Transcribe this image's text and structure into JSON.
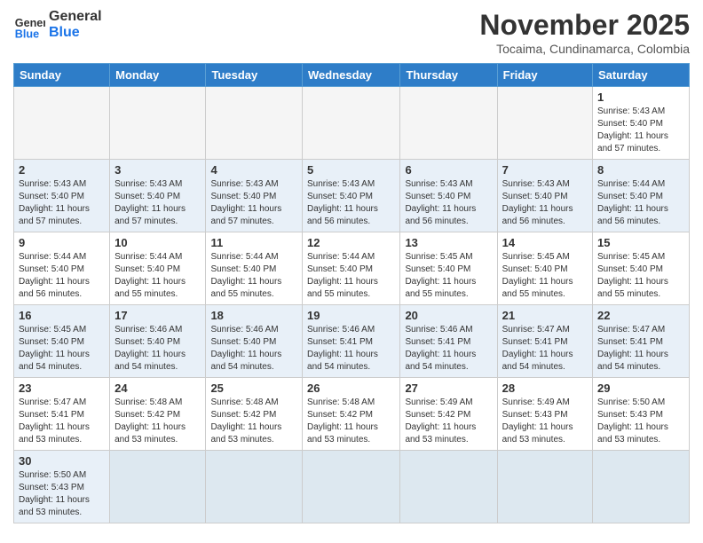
{
  "header": {
    "logo_general": "General",
    "logo_blue": "Blue",
    "month_title": "November 2025",
    "subtitle": "Tocaima, Cundinamarca, Colombia"
  },
  "days_of_week": [
    "Sunday",
    "Monday",
    "Tuesday",
    "Wednesday",
    "Thursday",
    "Friday",
    "Saturday"
  ],
  "weeks": [
    [
      {
        "day": "",
        "info": ""
      },
      {
        "day": "",
        "info": ""
      },
      {
        "day": "",
        "info": ""
      },
      {
        "day": "",
        "info": ""
      },
      {
        "day": "",
        "info": ""
      },
      {
        "day": "",
        "info": ""
      },
      {
        "day": "1",
        "info": "Sunrise: 5:43 AM\nSunset: 5:40 PM\nDaylight: 11 hours\nand 57 minutes."
      }
    ],
    [
      {
        "day": "2",
        "info": "Sunrise: 5:43 AM\nSunset: 5:40 PM\nDaylight: 11 hours\nand 57 minutes."
      },
      {
        "day": "3",
        "info": "Sunrise: 5:43 AM\nSunset: 5:40 PM\nDaylight: 11 hours\nand 57 minutes."
      },
      {
        "day": "4",
        "info": "Sunrise: 5:43 AM\nSunset: 5:40 PM\nDaylight: 11 hours\nand 57 minutes."
      },
      {
        "day": "5",
        "info": "Sunrise: 5:43 AM\nSunset: 5:40 PM\nDaylight: 11 hours\nand 56 minutes."
      },
      {
        "day": "6",
        "info": "Sunrise: 5:43 AM\nSunset: 5:40 PM\nDaylight: 11 hours\nand 56 minutes."
      },
      {
        "day": "7",
        "info": "Sunrise: 5:43 AM\nSunset: 5:40 PM\nDaylight: 11 hours\nand 56 minutes."
      },
      {
        "day": "8",
        "info": "Sunrise: 5:44 AM\nSunset: 5:40 PM\nDaylight: 11 hours\nand 56 minutes."
      }
    ],
    [
      {
        "day": "9",
        "info": "Sunrise: 5:44 AM\nSunset: 5:40 PM\nDaylight: 11 hours\nand 56 minutes."
      },
      {
        "day": "10",
        "info": "Sunrise: 5:44 AM\nSunset: 5:40 PM\nDaylight: 11 hours\nand 55 minutes."
      },
      {
        "day": "11",
        "info": "Sunrise: 5:44 AM\nSunset: 5:40 PM\nDaylight: 11 hours\nand 55 minutes."
      },
      {
        "day": "12",
        "info": "Sunrise: 5:44 AM\nSunset: 5:40 PM\nDaylight: 11 hours\nand 55 minutes."
      },
      {
        "day": "13",
        "info": "Sunrise: 5:45 AM\nSunset: 5:40 PM\nDaylight: 11 hours\nand 55 minutes."
      },
      {
        "day": "14",
        "info": "Sunrise: 5:45 AM\nSunset: 5:40 PM\nDaylight: 11 hours\nand 55 minutes."
      },
      {
        "day": "15",
        "info": "Sunrise: 5:45 AM\nSunset: 5:40 PM\nDaylight: 11 hours\nand 55 minutes."
      }
    ],
    [
      {
        "day": "16",
        "info": "Sunrise: 5:45 AM\nSunset: 5:40 PM\nDaylight: 11 hours\nand 54 minutes."
      },
      {
        "day": "17",
        "info": "Sunrise: 5:46 AM\nSunset: 5:40 PM\nDaylight: 11 hours\nand 54 minutes."
      },
      {
        "day": "18",
        "info": "Sunrise: 5:46 AM\nSunset: 5:40 PM\nDaylight: 11 hours\nand 54 minutes."
      },
      {
        "day": "19",
        "info": "Sunrise: 5:46 AM\nSunset: 5:41 PM\nDaylight: 11 hours\nand 54 minutes."
      },
      {
        "day": "20",
        "info": "Sunrise: 5:46 AM\nSunset: 5:41 PM\nDaylight: 11 hours\nand 54 minutes."
      },
      {
        "day": "21",
        "info": "Sunrise: 5:47 AM\nSunset: 5:41 PM\nDaylight: 11 hours\nand 54 minutes."
      },
      {
        "day": "22",
        "info": "Sunrise: 5:47 AM\nSunset: 5:41 PM\nDaylight: 11 hours\nand 54 minutes."
      }
    ],
    [
      {
        "day": "23",
        "info": "Sunrise: 5:47 AM\nSunset: 5:41 PM\nDaylight: 11 hours\nand 53 minutes."
      },
      {
        "day": "24",
        "info": "Sunrise: 5:48 AM\nSunset: 5:42 PM\nDaylight: 11 hours\nand 53 minutes."
      },
      {
        "day": "25",
        "info": "Sunrise: 5:48 AM\nSunset: 5:42 PM\nDaylight: 11 hours\nand 53 minutes."
      },
      {
        "day": "26",
        "info": "Sunrise: 5:48 AM\nSunset: 5:42 PM\nDaylight: 11 hours\nand 53 minutes."
      },
      {
        "day": "27",
        "info": "Sunrise: 5:49 AM\nSunset: 5:42 PM\nDaylight: 11 hours\nand 53 minutes."
      },
      {
        "day": "28",
        "info": "Sunrise: 5:49 AM\nSunset: 5:43 PM\nDaylight: 11 hours\nand 53 minutes."
      },
      {
        "day": "29",
        "info": "Sunrise: 5:50 AM\nSunset: 5:43 PM\nDaylight: 11 hours\nand 53 minutes."
      }
    ],
    [
      {
        "day": "30",
        "info": "Sunrise: 5:50 AM\nSunset: 5:43 PM\nDaylight: 11 hours\nand 53 minutes."
      },
      {
        "day": "",
        "info": ""
      },
      {
        "day": "",
        "info": ""
      },
      {
        "day": "",
        "info": ""
      },
      {
        "day": "",
        "info": ""
      },
      {
        "day": "",
        "info": ""
      },
      {
        "day": "",
        "info": ""
      }
    ]
  ]
}
